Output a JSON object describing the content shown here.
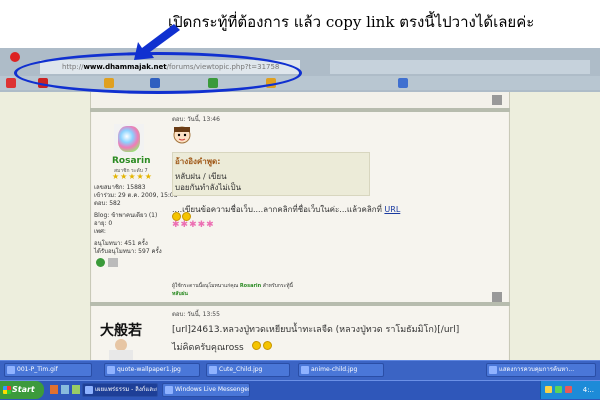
{
  "annotation": {
    "text": "เปิดกระทู้ที่ต้องการ แล้ว copy link ตรงนี้ไปวางได้เลยค่ะ",
    "arrow_color": "#1030d0",
    "ellipse_color": "#1030d0"
  },
  "browser": {
    "url_prefix": "http://",
    "url_domain": "www.dhammajak.net",
    "url_path": "/forums/viewtopic.php?t=31758",
    "bookmark_icons": [
      "red-round-icon",
      "youtube-icon",
      "star-icon",
      "window-icon",
      "globe-icon",
      "star-icon",
      "bookmark-icon"
    ]
  },
  "post1": {
    "username": "Rosarin",
    "rank": "สมาชิก ระดับ 7",
    "stars": "★★★★★",
    "info": [
      "เลขสมาชิก: 15883",
      "เข้าร่วม: 29 ต.ค. 2009, 15:08",
      "ตอบ: 582"
    ],
    "blog": "Blog: ข้าพาคนเดียว (1)",
    "age": "อายุ: 0",
    "gender": "เพศ:",
    "merit_in": "อนุโมทนา: 451 ครั้ง",
    "merit_out": "ได้รับอนุโมทนา: 597 ครั้ง",
    "time": "ตอบ: วันนี้, 13:46",
    "quote_title": "อ้างอิงคำพูด:",
    "quote_lines": [
      "หลับฝน / เขียน",
      "บอยกันทำลังไม่เป็น"
    ],
    "body": "....เขียนข้อความชื่อเว็บ....ลากคลิกที่ชื่อเว็บในค่ะ...แล้วคลิกที่",
    "body_link": "URL",
    "pink_stars": "✱✱✱✱✱",
    "signature_prefix": "ผู้ใช้กระดานนี้อนุโมทนาแก่คุณ",
    "signature_name": "Rosarin",
    "signature_suffix": "สำหรับกระทู้นี้",
    "signature_user": "หลับฝน"
  },
  "post2": {
    "time": "ตอบ: วันนี้, 13:55",
    "line1": "[url]24613.หลวงปู่ทวดเหยียบน้ำทะเลจืด (หลวงปู่ทวด ราโมธัมมิโก)[/url]",
    "line2": "ไม่คิดครับคุณross",
    "kanji": "大般若"
  },
  "taskbar": {
    "windows": [
      {
        "label": "001-P_Tim.gif"
      },
      {
        "label": "quote-wallpaper1.jpg"
      },
      {
        "label": "Cute_Child.jpg"
      },
      {
        "label": "anime-child.jpg"
      },
      {
        "label": "แสดงการควบคุมการค้นหา..."
      }
    ],
    "start_label": "Start",
    "active_windows": [
      {
        "label": "เผยแพร่ธรรม - ลิงก์และเว็บไ..."
      },
      {
        "label": "Windows Live Messenger"
      }
    ],
    "clock": "4:..",
    "colors": {
      "taskbar": "#3b64c4",
      "start": "#3c9a3c",
      "tray": "#1d8bd8"
    }
  }
}
